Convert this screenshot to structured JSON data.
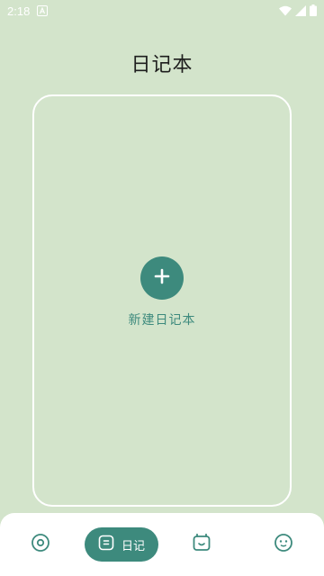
{
  "status_bar": {
    "time": "2:18",
    "icons": [
      "notification-a-icon",
      "wifi-icon",
      "signal-icon",
      "battery-icon"
    ]
  },
  "header": {
    "title": "日记本"
  },
  "notebook_area": {
    "add_button_icon": "plus-icon",
    "add_label": "新建日记本"
  },
  "bottom_nav": {
    "items": [
      {
        "icon": "target-icon",
        "label": "",
        "active": false
      },
      {
        "icon": "diary-icon",
        "label": "日记",
        "active": true
      },
      {
        "icon": "pet-face-icon",
        "label": "",
        "active": false
      },
      {
        "icon": "smiley-icon",
        "label": "",
        "active": false
      }
    ]
  },
  "colors": {
    "background": "#d3e4cb",
    "accent": "#3d8a7d",
    "card_border": "#ffffff",
    "nav_background": "#ffffff"
  }
}
